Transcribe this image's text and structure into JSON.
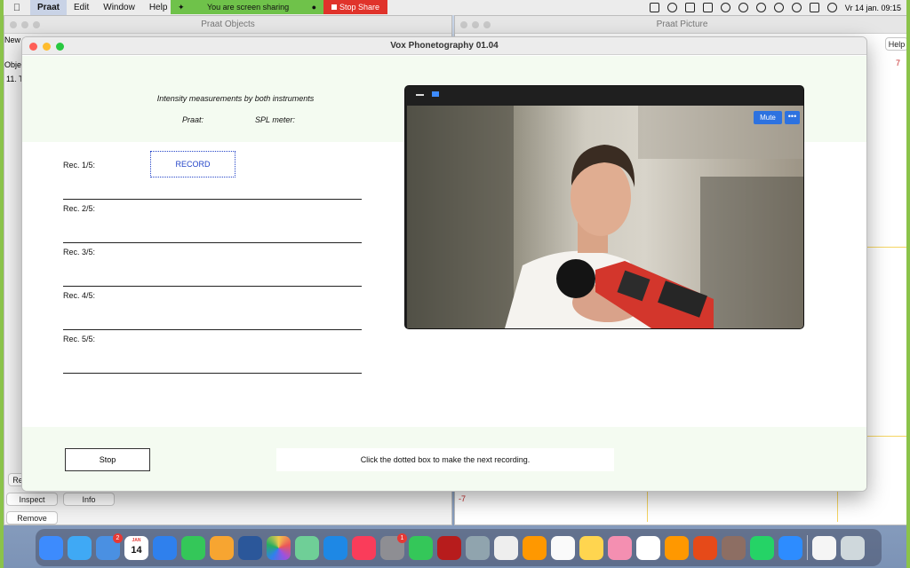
{
  "menubar": {
    "app_name": "Praat",
    "items": [
      "Edit",
      "Window",
      "Help"
    ],
    "share_text": "You are screen sharing",
    "stop_share": "Stop Share",
    "clock": "Vr 14 jan.  09:15"
  },
  "bg_windows": {
    "objects_title": "Praat Objects",
    "picture_title": "Praat Picture",
    "new_label": "New",
    "objects_label": "Obje",
    "item_label": "11. T",
    "help_label": "Help",
    "re_label": "Re",
    "inspect_label": "Inspect",
    "info_label": "Info",
    "remove_label": "Remove",
    "axis_top": "7",
    "axis_bottom": "-7"
  },
  "dialog": {
    "title": "Vox Phonetography 01.04",
    "heading": "Intensity measurements by both instruments",
    "praat_label": "Praat:",
    "spl_label": "SPL meter:",
    "recordings": [
      {
        "label": "Rec. 1/5:"
      },
      {
        "label": "Rec. 2/5:"
      },
      {
        "label": "Rec. 3/5:"
      },
      {
        "label": "Rec. 4/5:"
      },
      {
        "label": "Rec. 5/5:"
      }
    ],
    "record_button": "RECORD",
    "stop_button": "Stop",
    "instruction": "Click the dotted box to make the next recording."
  },
  "video": {
    "mute_label": "Mute",
    "more_label": "•••"
  },
  "dock": {
    "calendar_month": "JAN",
    "calendar_day": "14",
    "mail_badge": "2",
    "settings_badge": "1",
    "apps": [
      {
        "name": "finder",
        "color": "#3d8bfd"
      },
      {
        "name": "safari",
        "color": "#3fa9f5"
      },
      {
        "name": "mail",
        "color": "#4a90e2"
      },
      {
        "name": "calendar",
        "color": "#ffffff"
      },
      {
        "name": "keynote",
        "color": "#2f80ed"
      },
      {
        "name": "numbers",
        "color": "#34c759"
      },
      {
        "name": "pages",
        "color": "#f7a531"
      },
      {
        "name": "word",
        "color": "#2b579a"
      },
      {
        "name": "photos",
        "color": "#f2c94c"
      },
      {
        "name": "maps",
        "color": "#6fcf97"
      },
      {
        "name": "app-store",
        "color": "#1e88e5"
      },
      {
        "name": "music",
        "color": "#fa3c5a"
      },
      {
        "name": "system-preferences",
        "color": "#8e8e93"
      },
      {
        "name": "messages",
        "color": "#34c759"
      },
      {
        "name": "mendeley",
        "color": "#b71c1c"
      },
      {
        "name": "preview",
        "color": "#90a4ae"
      },
      {
        "name": "texmaker",
        "color": "#eeeeee"
      },
      {
        "name": "sublime-text",
        "color": "#ff9800"
      },
      {
        "name": "textedit",
        "color": "#fafafa"
      },
      {
        "name": "notes",
        "color": "#ffd54f"
      },
      {
        "name": "scrolls",
        "color": "#f48fb1"
      },
      {
        "name": "reminders",
        "color": "#ffffff"
      },
      {
        "name": "home",
        "color": "#ff9800"
      },
      {
        "name": "remote-desktop",
        "color": "#e64a19"
      },
      {
        "name": "praat",
        "color": "#8d6e63"
      },
      {
        "name": "whatsapp",
        "color": "#25d366"
      },
      {
        "name": "zoom",
        "color": "#2d8cff"
      }
    ]
  }
}
